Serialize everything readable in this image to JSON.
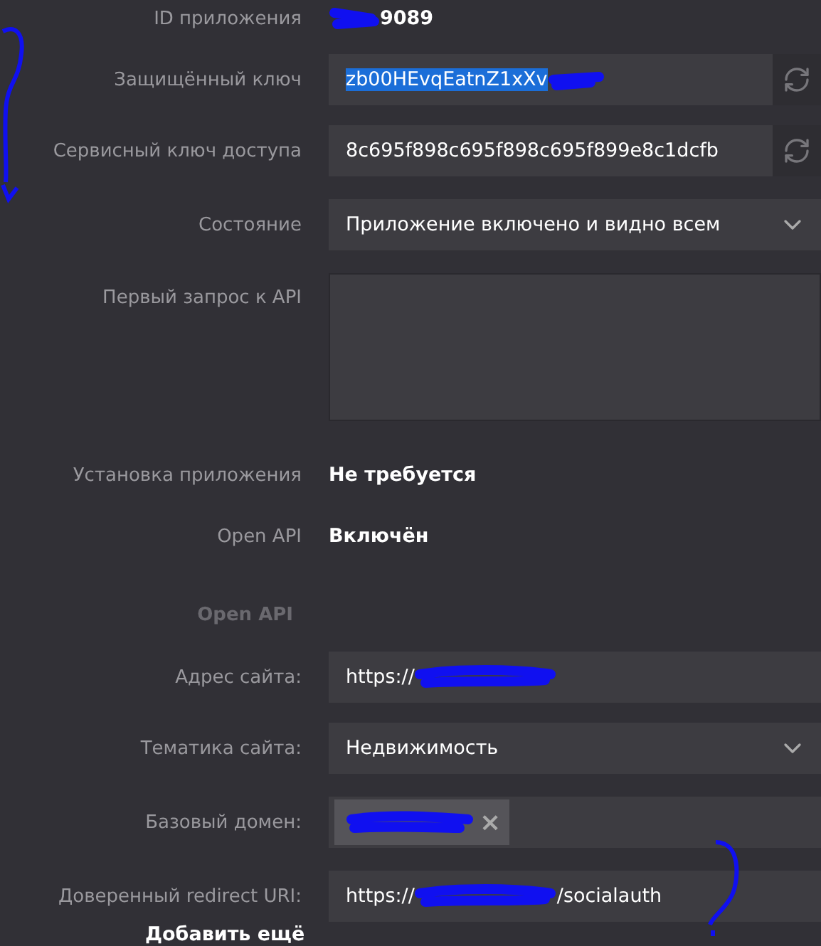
{
  "app_id": {
    "label": "ID приложения",
    "value": "9089"
  },
  "rows": [
    {
      "kind": "key",
      "label": "Защищённый ключ",
      "value": "zb00HEvqEatnZ1xXv",
      "selected": true
    },
    {
      "kind": "key",
      "label": "Сервисный ключ доступа",
      "value": "8c695f898c695f898c695f899e8c1dcfb",
      "selected": false
    },
    {
      "kind": "select",
      "label": "Состояние",
      "value": "Приложение включено и видно всем"
    },
    {
      "kind": "textarea",
      "label": "Первый запрос к API"
    },
    {
      "kind": "text",
      "label": "Установка приложения",
      "value": "Не требуется"
    },
    {
      "kind": "text",
      "label": "Open API",
      "value": "Включён"
    },
    {
      "kind": "heading",
      "label": "Open API"
    },
    {
      "kind": "url",
      "label": "Адрес сайта:",
      "value": "https://"
    },
    {
      "kind": "select",
      "label": "Тематика сайта:",
      "value": "Недвижимость"
    },
    {
      "kind": "chips",
      "label": "Базовый домен:",
      "chip_close": "×"
    },
    {
      "kind": "url",
      "label": "Доверенный redirect URI:",
      "value": "https://",
      "suffix": "/socialauth"
    }
  ],
  "add_more": "Добавить ещё"
}
